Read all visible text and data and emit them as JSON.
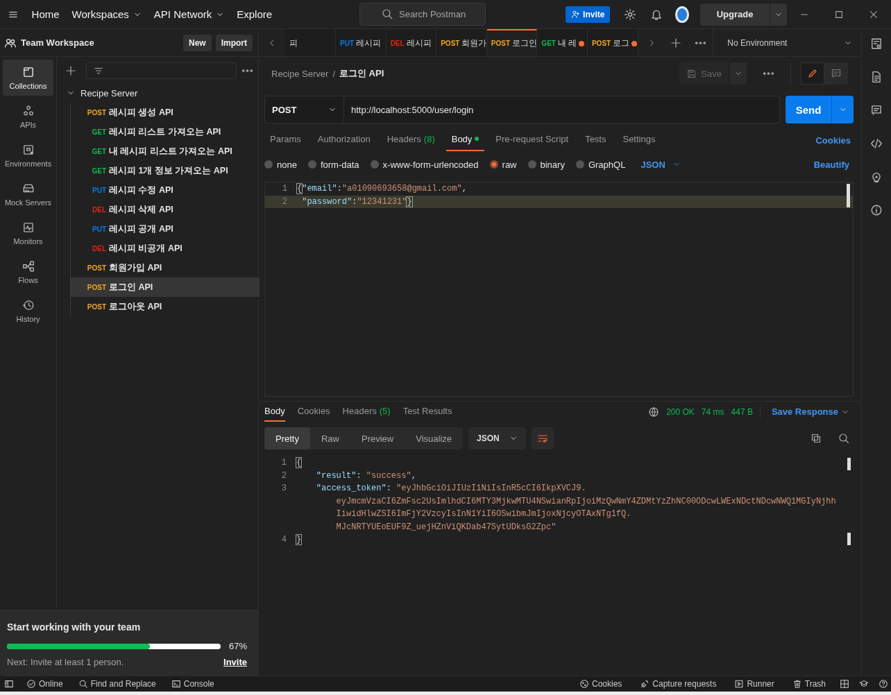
{
  "topbar": {
    "nav": [
      {
        "label": "Home",
        "dropdown": false
      },
      {
        "label": "Workspaces",
        "dropdown": true
      },
      {
        "label": "API Network",
        "dropdown": true
      },
      {
        "label": "Explore",
        "dropdown": false
      }
    ],
    "search": {
      "placeholder": "Search Postman"
    },
    "invite": "Invite",
    "upgrade": "Upgrade"
  },
  "workspace": {
    "title": "Team Workspace",
    "buttons": [
      "New",
      "Import"
    ]
  },
  "rail": [
    {
      "label": "Collections",
      "selected": true
    },
    {
      "label": "APIs",
      "selected": false
    },
    {
      "label": "Environments",
      "selected": false
    },
    {
      "label": "Mock Servers",
      "selected": false
    },
    {
      "label": "Monitors",
      "selected": false
    },
    {
      "label": "Flows",
      "selected": false
    },
    {
      "label": "History",
      "selected": false
    }
  ],
  "collection": {
    "name": "Recipe Server",
    "expanded": true,
    "children": [
      {
        "method": "POST",
        "color": "#f5a623",
        "name": "레시피 생성 API",
        "selected": false
      },
      {
        "method": "GET",
        "color": "#0cbb52",
        "name": "레시피 리스트 가져오는 API",
        "selected": false
      },
      {
        "method": "GET",
        "color": "#0cbb52",
        "name": "내 레시피 리스트 가져오는 API",
        "selected": false
      },
      {
        "method": "GET",
        "color": "#0cbb52",
        "name": "레시피 1개 정보 가져오는 API",
        "selected": false
      },
      {
        "method": "PUT",
        "color": "#097bed",
        "name": "레시피 수정 API",
        "selected": false
      },
      {
        "method": "DEL",
        "color": "#eb2013",
        "name": "레시피 삭제 API",
        "selected": false
      },
      {
        "method": "PUT",
        "color": "#097bed",
        "name": "레시피 공개 API",
        "selected": false
      },
      {
        "method": "DEL",
        "color": "#eb2013",
        "name": "레시피 비공개 API",
        "selected": false
      },
      {
        "method": "POST",
        "color": "#f5a623",
        "name": "회원가입 API",
        "selected": false
      },
      {
        "method": "POST",
        "color": "#f5a623",
        "name": "로그인 API",
        "selected": true
      },
      {
        "method": "POST",
        "color": "#f5a623",
        "name": "로그아웃 API",
        "selected": false
      }
    ]
  },
  "team_card": {
    "title": "Start working with your team",
    "level": 0.67,
    "percent": "67%",
    "next": "Next: Invite at least 1 person.",
    "link": "Invite"
  },
  "tabs": [
    {
      "name": "피",
      "selected": false,
      "unsaved": false
    },
    {
      "method": "PUT",
      "color": "#097bed",
      "name": "레시피",
      "selected": false,
      "unsaved": false
    },
    {
      "method": "DEL",
      "color": "#eb2013",
      "name": "레시피",
      "selected": false,
      "unsaved": false
    },
    {
      "method": "POST",
      "color": "#f5a623",
      "name": "회원가",
      "selected": false,
      "unsaved": false
    },
    {
      "method": "POST",
      "color": "#f5a623",
      "name": "로그인",
      "selected": true,
      "unsaved": false
    },
    {
      "method": "GET",
      "color": "#0cbb52",
      "name": "내 레",
      "selected": false,
      "unsaved": true
    },
    {
      "method": "POST",
      "color": "#f5a623",
      "name": "로그",
      "selected": false,
      "unsaved": true
    }
  ],
  "environment": "No Environment",
  "breadcrumb": {
    "parent": "Recipe Server",
    "separator": "/",
    "current": "로그인 API"
  },
  "save": "Save",
  "request": {
    "method": "POST",
    "url": "http://localhost:5000/user/login",
    "send": "Send"
  },
  "request_tabs": [
    {
      "label": "Params",
      "selected": false
    },
    {
      "label": "Authorization",
      "selected": false
    },
    {
      "label": "Headers",
      "count": "(8)",
      "selected": false
    },
    {
      "label": "Body",
      "dot": true,
      "selected": true
    },
    {
      "label": "Pre-request Script",
      "selected": false
    },
    {
      "label": "Tests",
      "selected": false
    },
    {
      "label": "Settings",
      "selected": false
    }
  ],
  "cookies_link": "Cookies",
  "body_types": [
    {
      "label": "none",
      "selected": false
    },
    {
      "label": "form-data",
      "selected": false
    },
    {
      "label": "x-www-form-urlencoded",
      "selected": false
    },
    {
      "label": "raw",
      "selected": true
    },
    {
      "label": "binary",
      "selected": false
    },
    {
      "label": "GraphQL",
      "selected": false
    }
  ],
  "body_language": "JSON",
  "beautify": "Beautify",
  "request_body": [
    {
      "number": "1",
      "highlighted": false,
      "tokens": [
        {
          "kind": "match",
          "text": "{"
        },
        {
          "kind": "key",
          "text": "\"email\""
        },
        {
          "kind": "punct",
          "text": ":"
        },
        {
          "kind": "string",
          "text": "\"a01090693658@gmail.com\""
        },
        {
          "kind": "punct",
          "text": ","
        }
      ]
    },
    {
      "number": "2",
      "highlighted": true,
      "tokens": [
        {
          "kind": "key",
          "text": " \"password\""
        },
        {
          "kind": "punct",
          "text": ":"
        },
        {
          "kind": "string",
          "text": "\"12341231\""
        },
        {
          "kind": "match",
          "text": "}"
        }
      ]
    }
  ],
  "response_tabs": [
    {
      "label": "Body",
      "selected": true
    },
    {
      "label": "Cookies",
      "selected": false
    },
    {
      "label": "Headers",
      "count": "(5)",
      "selected": false
    },
    {
      "label": "Test Results",
      "selected": false
    }
  ],
  "response_status": {
    "status": "200 OK",
    "time": "74 ms",
    "size": "447 B",
    "save": "Save Response"
  },
  "view_modes": [
    {
      "label": "Pretty",
      "selected": true
    },
    {
      "label": "Raw",
      "selected": false
    },
    {
      "label": "Preview",
      "selected": false
    },
    {
      "label": "Visualize",
      "selected": false
    }
  ],
  "response_format": "JSON",
  "response_body": [
    {
      "number": "1",
      "tokens": [
        {
          "kind": "match",
          "text": "{"
        }
      ]
    },
    {
      "number": "2",
      "tokens": [
        {
          "kind": "key",
          "text": "    \"result\""
        },
        {
          "kind": "punct",
          "text": ": "
        },
        {
          "kind": "string",
          "text": "\"success\""
        },
        {
          "kind": "punct",
          "text": ","
        }
      ]
    },
    {
      "number": "3",
      "tokens": [
        {
          "kind": "key",
          "text": "    \"access_token\""
        },
        {
          "kind": "punct",
          "text": ": "
        },
        {
          "kind": "string",
          "text": "\"eyJhbGciOiJIUzI1NiIsInR5cCI6IkpXVCJ9."
        }
      ],
      "wrapped": [
        "eyJmcmVzaCI6ZmFsc2UsImlhdCI6MTY3MjkwMTU4NSwianRpIjoiMzQwNmY4ZDMtYzZhNC00ODcwLWExNDctNDcwNWQ1MGIyNjhh",
        "IiwidHlwZSI6ImFjY2VzcyIsInN1YiI6OSwibmJmIjoxNjcyOTAxNTg1fQ.",
        "MJcNRTYUEoEUF9Z_uejHZnViQKDab47SytUDksG2Zpc\""
      ]
    },
    {
      "number": "4",
      "tokens": [
        {
          "kind": "match",
          "text": "}"
        }
      ]
    }
  ],
  "status_bar": {
    "left": [
      "Online",
      "Find and Replace",
      "Console"
    ],
    "right": [
      "Cookies",
      "Capture requests",
      "Runner",
      "Trash"
    ]
  }
}
